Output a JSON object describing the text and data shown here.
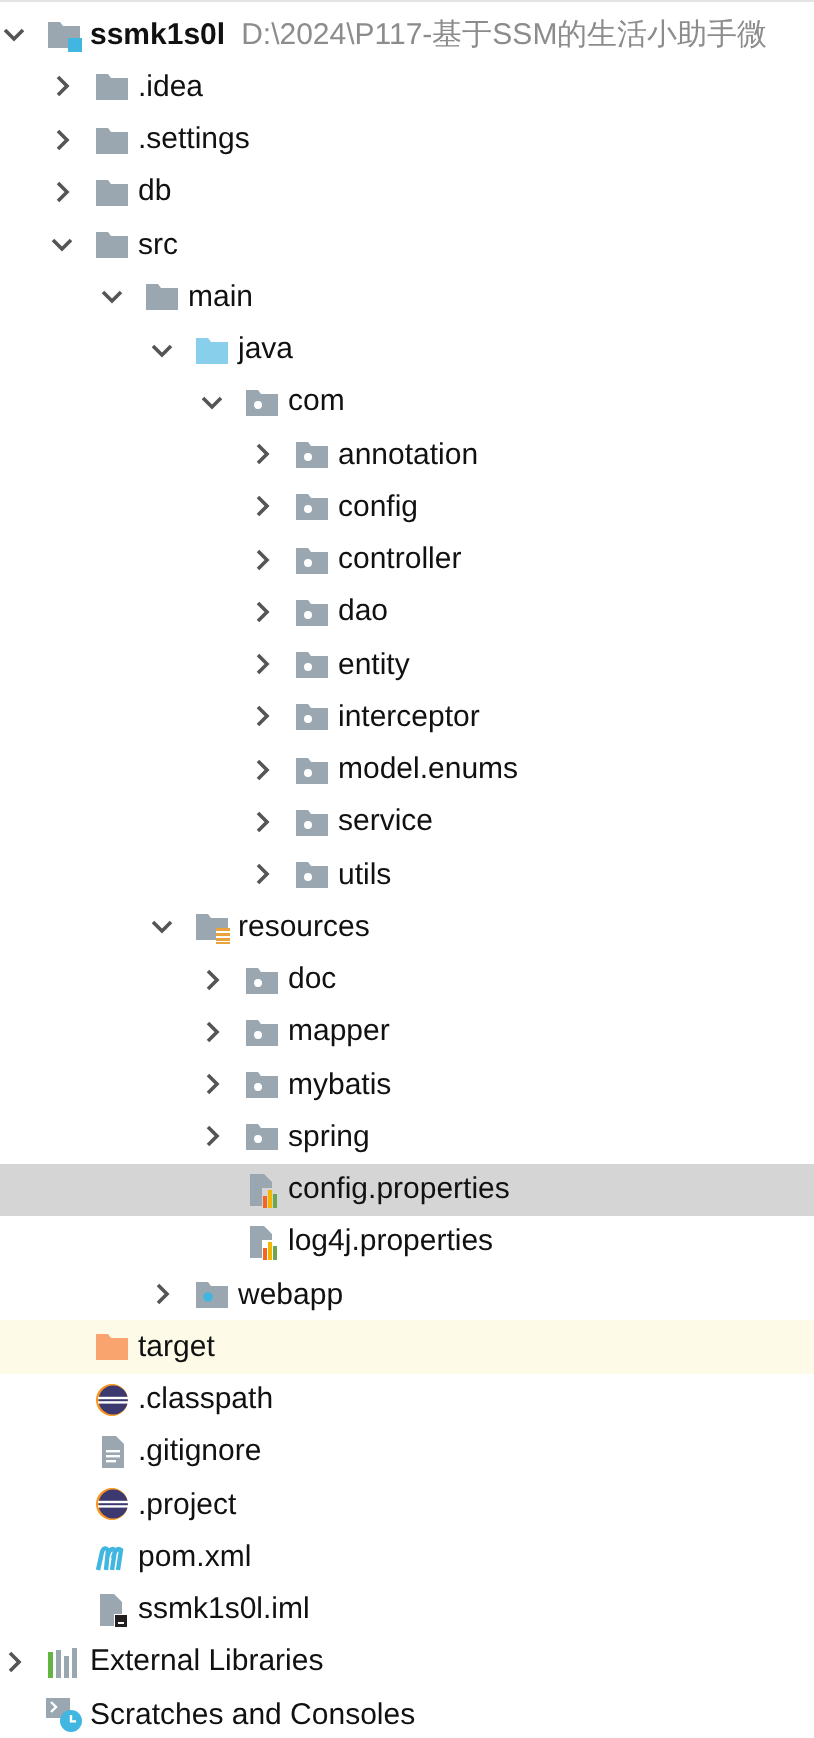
{
  "project_tree": [
    {
      "name": "ssmk1s0l",
      "path": "D:\\2024\\P117-基于SSM的生活小助手微",
      "kind": "module",
      "expanded": true,
      "selected": false,
      "excluded": false,
      "children": [
        {
          "name": ".idea",
          "kind": "folder",
          "expanded": false,
          "selected": false,
          "excluded": false
        },
        {
          "name": ".settings",
          "kind": "folder",
          "expanded": false,
          "selected": false,
          "excluded": false
        },
        {
          "name": "db",
          "kind": "folder",
          "expanded": false,
          "selected": false,
          "excluded": false
        },
        {
          "name": "src",
          "kind": "folder",
          "expanded": true,
          "selected": false,
          "excluded": false,
          "children": [
            {
              "name": "main",
              "kind": "folder",
              "expanded": true,
              "selected": false,
              "excluded": false,
              "children": [
                {
                  "name": "java",
                  "kind": "source",
                  "expanded": true,
                  "selected": false,
                  "excluded": false,
                  "children": [
                    {
                      "name": "com",
                      "kind": "package",
                      "expanded": true,
                      "selected": false,
                      "excluded": false,
                      "children": [
                        {
                          "name": "annotation",
                          "kind": "package",
                          "expanded": false,
                          "selected": false,
                          "excluded": false
                        },
                        {
                          "name": "config",
                          "kind": "package",
                          "expanded": false,
                          "selected": false,
                          "excluded": false
                        },
                        {
                          "name": "controller",
                          "kind": "package",
                          "expanded": false,
                          "selected": false,
                          "excluded": false
                        },
                        {
                          "name": "dao",
                          "kind": "package",
                          "expanded": false,
                          "selected": false,
                          "excluded": false
                        },
                        {
                          "name": "entity",
                          "kind": "package",
                          "expanded": false,
                          "selected": false,
                          "excluded": false
                        },
                        {
                          "name": "interceptor",
                          "kind": "package",
                          "expanded": false,
                          "selected": false,
                          "excluded": false
                        },
                        {
                          "name": "model.enums",
                          "kind": "package",
                          "expanded": false,
                          "selected": false,
                          "excluded": false
                        },
                        {
                          "name": "service",
                          "kind": "package",
                          "expanded": false,
                          "selected": false,
                          "excluded": false
                        },
                        {
                          "name": "utils",
                          "kind": "package",
                          "expanded": false,
                          "selected": false,
                          "excluded": false
                        }
                      ]
                    }
                  ]
                },
                {
                  "name": "resources",
                  "kind": "resources",
                  "expanded": true,
                  "selected": false,
                  "excluded": false,
                  "children": [
                    {
                      "name": "doc",
                      "kind": "package",
                      "expanded": false,
                      "selected": false,
                      "excluded": false
                    },
                    {
                      "name": "mapper",
                      "kind": "package",
                      "expanded": false,
                      "selected": false,
                      "excluded": false
                    },
                    {
                      "name": "mybatis",
                      "kind": "package",
                      "expanded": false,
                      "selected": false,
                      "excluded": false
                    },
                    {
                      "name": "spring",
                      "kind": "package",
                      "expanded": false,
                      "selected": false,
                      "excluded": false
                    },
                    {
                      "name": "config.properties",
                      "kind": "properties",
                      "selected": true,
                      "excluded": false
                    },
                    {
                      "name": "log4j.properties",
                      "kind": "properties",
                      "selected": false,
                      "excluded": false
                    }
                  ]
                },
                {
                  "name": "webapp",
                  "kind": "web",
                  "expanded": false,
                  "selected": false,
                  "excluded": false
                }
              ]
            }
          ]
        },
        {
          "name": "target",
          "kind": "excluded-folder",
          "selected": false,
          "excluded": true
        },
        {
          "name": ".classpath",
          "kind": "eclipse",
          "selected": false,
          "excluded": false
        },
        {
          "name": ".gitignore",
          "kind": "text",
          "selected": false,
          "excluded": false
        },
        {
          "name": ".project",
          "kind": "eclipse",
          "selected": false,
          "excluded": false
        },
        {
          "name": "pom.xml",
          "kind": "maven",
          "selected": false,
          "excluded": false
        },
        {
          "name": "ssmk1s0l.iml",
          "kind": "iml",
          "selected": false,
          "excluded": false
        }
      ]
    },
    {
      "name": "External Libraries",
      "kind": "libraries",
      "expanded": false,
      "selected": false,
      "excluded": false
    },
    {
      "name": "Scratches and Consoles",
      "kind": "scratches",
      "selected": false,
      "excluded": false
    }
  ]
}
